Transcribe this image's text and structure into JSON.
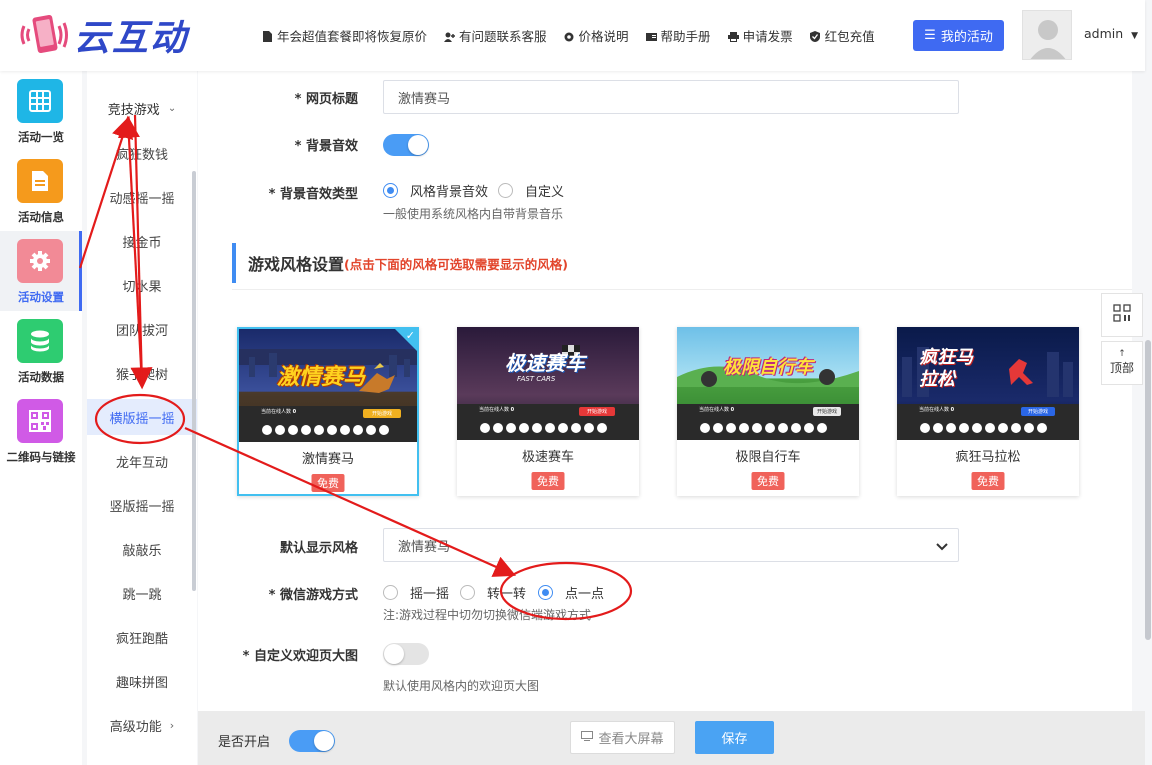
{
  "brand": {
    "name": "云互动"
  },
  "header": {
    "nav": [
      {
        "label": "年会超值套餐即将恢复原价",
        "icon": "document-icon"
      },
      {
        "label": "有问题联系客服",
        "icon": "user-add-icon"
      },
      {
        "label": "价格说明",
        "icon": "settings-icon"
      },
      {
        "label": "帮助手册",
        "icon": "book-icon"
      },
      {
        "label": "申请发票",
        "icon": "printer-icon"
      },
      {
        "label": "红包充值",
        "icon": "shield-icon"
      }
    ],
    "my_activity": "我的活动",
    "user": "admin"
  },
  "iconbar": [
    {
      "label": "活动一览",
      "color": "#1fb6e6"
    },
    {
      "label": "活动信息",
      "color": "#f59a1c"
    },
    {
      "label": "活动设置",
      "color": "#f28a96"
    },
    {
      "label": "活动数据",
      "color": "#2ecc71"
    },
    {
      "label": "二维码与链接",
      "color": "#d05ae6"
    }
  ],
  "subbar": {
    "group": "竞技游戏",
    "items": [
      "疯狂数钱",
      "动感摇一摇",
      "接金币",
      "切水果",
      "团队拔河",
      "猴子爬树",
      "横版摇一摇",
      "龙年互动",
      "竖版摇一摇",
      "敲敲乐",
      "跳一跳",
      "疯狂跑酷",
      "趣味拼图"
    ],
    "advanced": "高级功能"
  },
  "form": {
    "page_title_label": "* 网页标题",
    "page_title_value": "激情赛马",
    "bg_sound_label": "* 背景音效",
    "bg_sound_type_label": "* 背景音效类型",
    "bg_sound_opts": [
      "风格背景音效",
      "自定义"
    ],
    "bg_sound_hint": "一般使用系统风格内自带背景音乐",
    "section_title": "游戏风格设置",
    "section_sub": "(点击下面的风格可选取需要显示的风格)",
    "styles": [
      {
        "name": "激情赛马",
        "badge": "免费",
        "thumb_title": "激情赛马",
        "btn": "开始游戏"
      },
      {
        "name": "极速赛车",
        "badge": "免费",
        "thumb_title": "极速赛车",
        "thumb_sub": "FAST CARS",
        "btn": "开始游戏"
      },
      {
        "name": "极限自行车",
        "badge": "免费",
        "thumb_title": "极限自行车",
        "btn": "开始游戏"
      },
      {
        "name": "疯狂马拉松",
        "badge": "免费",
        "thumb_title": "疯狂马拉松",
        "btn": "开始游戏"
      }
    ],
    "online_text": "当前在线人数",
    "online_count": "0",
    "default_style_label": "默认显示风格",
    "default_style_value": "激情赛马",
    "wechat_mode_label": "* 微信游戏方式",
    "wechat_opts": [
      "摇一摇",
      "转一转",
      "点一点"
    ],
    "wechat_hint": "注:游戏过程中切勿切换微信端游戏方式",
    "welcome_label": "* 自定义欢迎页大图",
    "welcome_hint": "默认使用风格内的欢迎页大图"
  },
  "float": {
    "top": "顶部"
  },
  "bottom": {
    "enable_label": "是否开启",
    "view_screen": "查看大屏幕",
    "save": "保存"
  }
}
